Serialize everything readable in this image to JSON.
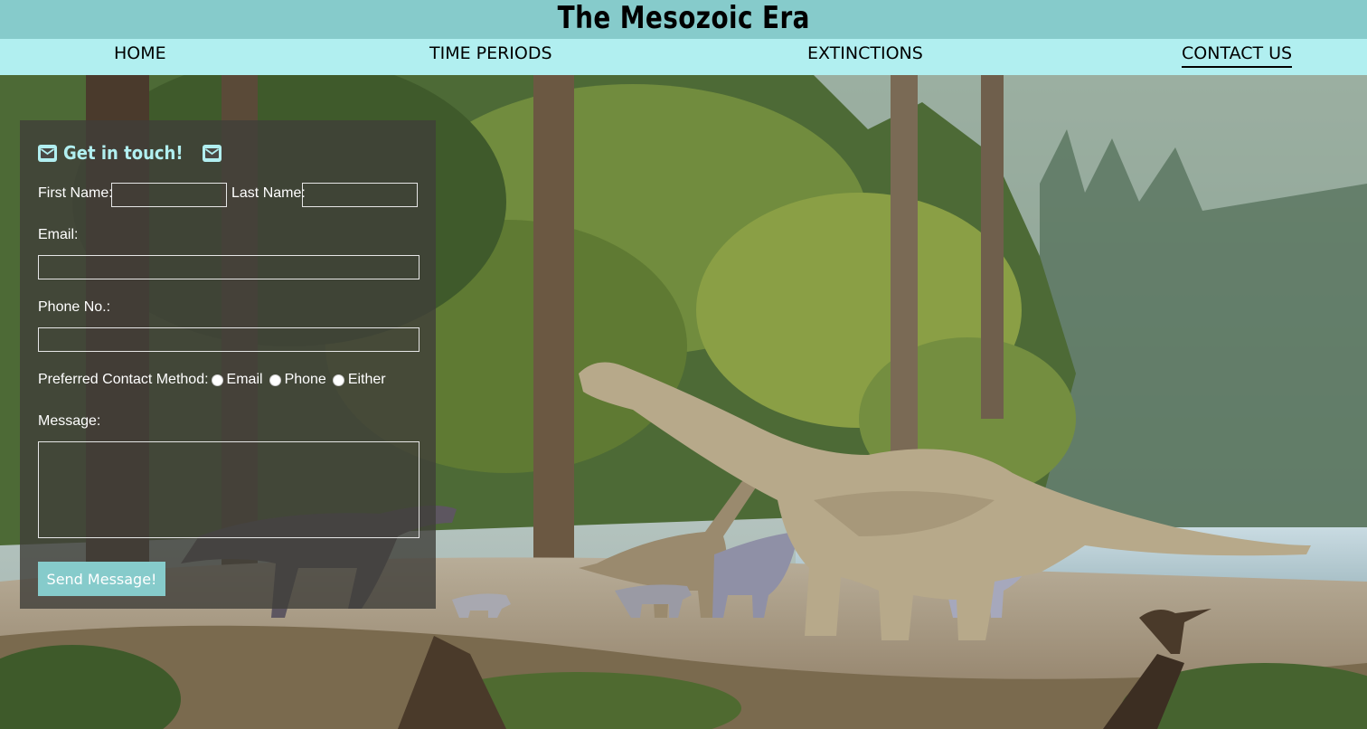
{
  "header": {
    "title": "The Mesozoic Era"
  },
  "nav": {
    "items": [
      {
        "label": "HOME"
      },
      {
        "label": "TIME PERIODS"
      },
      {
        "label": "EXTINCTIONS"
      },
      {
        "label": "CONTACT US",
        "active": true
      }
    ]
  },
  "contact": {
    "title": "Get in touch!",
    "first_name_label": "First Name:",
    "last_name_label": "Last Name:",
    "email_label": "Email:",
    "phone_label": "Phone No.:",
    "preferred_label": "Preferred Contact Method:",
    "methods": [
      "Email",
      "Phone",
      "Either"
    ],
    "message_label": "Message:",
    "send_label": "Send Message!",
    "first_name_value": "",
    "last_name_value": "",
    "email_value": "",
    "phone_value": "",
    "message_value": ""
  },
  "colors": {
    "title_bar": "#86cbcb",
    "nav_bar": "#b1eff0",
    "accent": "#b1eff0",
    "button": "#86cbcb",
    "panel": "rgba(64,62,58,0.80)"
  },
  "icons": {
    "panel_title": "envelope-icon"
  }
}
